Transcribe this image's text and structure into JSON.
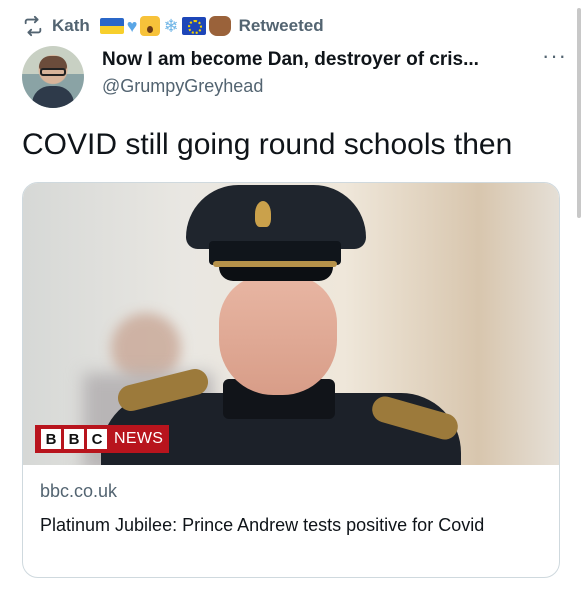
{
  "retweet": {
    "user": "Kath",
    "label": "Retweeted",
    "emoji_icons": [
      "ukraine-flag",
      "blue-heart",
      "screaming-face",
      "snowflake",
      "eu-flag",
      "raised-fist"
    ]
  },
  "author": {
    "display_name": "Now I am become Dan, destroyer of cris...",
    "handle": "@GrumpyGreyhead",
    "more_label": "···"
  },
  "tweet": {
    "text": "COVID still going round schools then"
  },
  "card": {
    "bbc_letters": [
      "B",
      "B",
      "C"
    ],
    "bbc_news_label": "NEWS",
    "domain": "bbc.co.uk",
    "headline": "Platinum Jubilee: Prince Andrew tests positive for Covid"
  },
  "colors": {
    "secondary_text": "#536471",
    "primary_text": "#0f1419",
    "card_border": "#cfd9de",
    "bbc_red": "#b8141d"
  }
}
